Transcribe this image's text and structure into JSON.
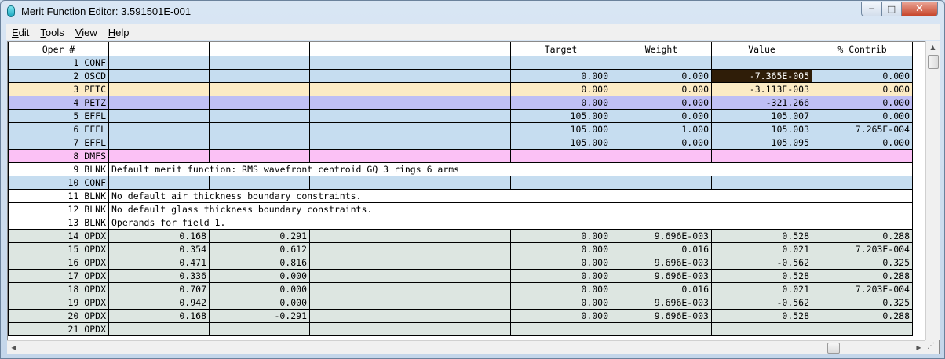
{
  "window": {
    "title": "Merit Function Editor: 3.591501E-001",
    "min_glyph": "─",
    "max_glyph": "□",
    "close_glyph": "✕"
  },
  "menu": [
    {
      "label": "Edit",
      "key": "E",
      "rest": "dit"
    },
    {
      "label": "Tools",
      "key": "T",
      "rest": "ools"
    },
    {
      "label": "View",
      "key": "V",
      "rest": "iew"
    },
    {
      "label": "Help",
      "key": "H",
      "rest": "elp"
    }
  ],
  "table": {
    "headers": [
      "Oper #",
      "",
      "",
      "",
      "",
      "Target",
      "Weight",
      "Value",
      "% Contrib"
    ],
    "rows": [
      {
        "n": "1",
        "op": "CONF",
        "type": "conf",
        "cells": [
          "",
          "",
          "",
          "",
          "",
          "",
          "",
          ""
        ]
      },
      {
        "n": "2",
        "op": "OSCD",
        "type": "osc",
        "cells": [
          "",
          "",
          "",
          "",
          "0.000",
          "0.000",
          "-7.365E-005",
          "0.000"
        ],
        "selected": 6
      },
      {
        "n": "3",
        "op": "PETC",
        "type": "petc",
        "cells": [
          "",
          "",
          "",
          "",
          "0.000",
          "0.000",
          "-3.113E-003",
          "0.000"
        ]
      },
      {
        "n": "4",
        "op": "PETZ",
        "type": "petz",
        "cells": [
          "",
          "",
          "",
          "",
          "0.000",
          "0.000",
          "-321.266",
          "0.000"
        ]
      },
      {
        "n": "5",
        "op": "EFFL",
        "type": "effl",
        "cells": [
          "",
          "",
          "",
          "",
          "105.000",
          "0.000",
          "105.007",
          "0.000"
        ]
      },
      {
        "n": "6",
        "op": "EFFL",
        "type": "effl",
        "cells": [
          "",
          "",
          "",
          "",
          "105.000",
          "1.000",
          "105.003",
          "7.265E-004"
        ]
      },
      {
        "n": "7",
        "op": "EFFL",
        "type": "effl",
        "cells": [
          "",
          "",
          "",
          "",
          "105.000",
          "0.000",
          "105.095",
          "0.000"
        ]
      },
      {
        "n": "8",
        "op": "DMFS",
        "type": "dmfs",
        "cells": [
          "",
          "",
          "",
          "",
          "",
          "",
          "",
          ""
        ]
      },
      {
        "n": "9",
        "op": "BLNK",
        "type": "blnk",
        "text": "Default merit function: RMS wavefront centroid GQ 3 rings 6 arms"
      },
      {
        "n": "10",
        "op": "CONF",
        "type": "conf",
        "cells": [
          "",
          "",
          "",
          "",
          "",
          "",
          "",
          ""
        ]
      },
      {
        "n": "11",
        "op": "BLNK",
        "type": "blnk",
        "text": "No default air thickness boundary constraints."
      },
      {
        "n": "12",
        "op": "BLNK",
        "type": "blnk",
        "text": "No default glass thickness boundary constraints."
      },
      {
        "n": "13",
        "op": "BLNK",
        "type": "blnk",
        "text": "Operands for field 1."
      },
      {
        "n": "14",
        "op": "OPDX",
        "type": "opdx",
        "cells": [
          "0.168",
          "0.291",
          "",
          "",
          "0.000",
          "9.696E-003",
          "0.528",
          "0.288"
        ]
      },
      {
        "n": "15",
        "op": "OPDX",
        "type": "opdx",
        "cells": [
          "0.354",
          "0.612",
          "",
          "",
          "0.000",
          "0.016",
          "0.021",
          "7.203E-004"
        ]
      },
      {
        "n": "16",
        "op": "OPDX",
        "type": "opdx",
        "cells": [
          "0.471",
          "0.816",
          "",
          "",
          "0.000",
          "9.696E-003",
          "-0.562",
          "0.325"
        ]
      },
      {
        "n": "17",
        "op": "OPDX",
        "type": "opdx",
        "cells": [
          "0.336",
          "0.000",
          "",
          "",
          "0.000",
          "9.696E-003",
          "0.528",
          "0.288"
        ]
      },
      {
        "n": "18",
        "op": "OPDX",
        "type": "opdx",
        "cells": [
          "0.707",
          "0.000",
          "",
          "",
          "0.000",
          "0.016",
          "0.021",
          "7.203E-004"
        ]
      },
      {
        "n": "19",
        "op": "OPDX",
        "type": "opdx",
        "cells": [
          "0.942",
          "0.000",
          "",
          "",
          "0.000",
          "9.696E-003",
          "-0.562",
          "0.325"
        ]
      },
      {
        "n": "20",
        "op": "OPDX",
        "type": "opdx",
        "cells": [
          "0.168",
          "-0.291",
          "",
          "",
          "0.000",
          "9.696E-003",
          "0.528",
          "0.288"
        ]
      },
      {
        "n": "21",
        "op": "OPDX",
        "type": "opdx",
        "cells": [
          "",
          "",
          "",
          "",
          "",
          "",
          "",
          ""
        ]
      }
    ]
  },
  "scroll": {
    "up": "▲",
    "down": "▼",
    "left": "◀",
    "right": "▶",
    "grip": "⋰"
  }
}
